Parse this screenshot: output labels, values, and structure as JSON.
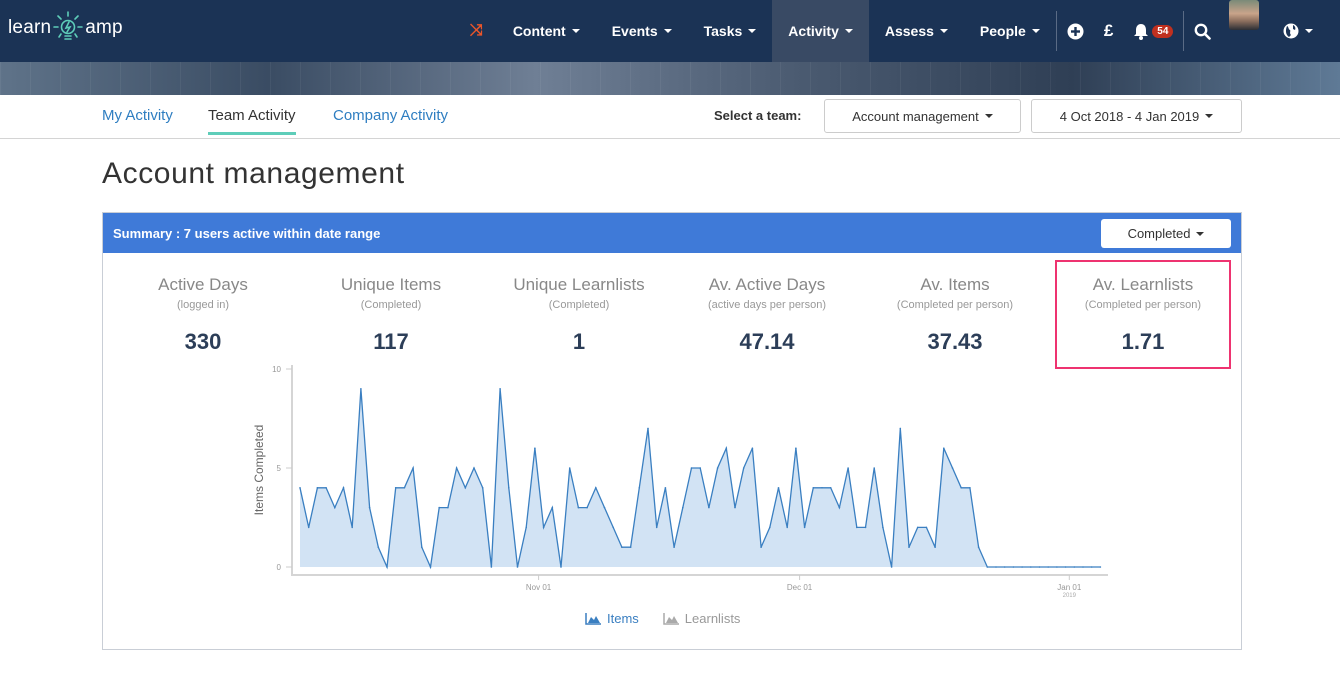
{
  "app": {
    "logo_left": "learn",
    "logo_right": "amp"
  },
  "nav": {
    "items": [
      {
        "label": "Content",
        "active": false
      },
      {
        "label": "Events",
        "active": false
      },
      {
        "label": "Tasks",
        "active": false
      },
      {
        "label": "Activity",
        "active": true
      },
      {
        "label": "Assess",
        "active": false
      },
      {
        "label": "People",
        "active": false
      }
    ],
    "icons": {
      "shuffle": "shuffle-icon",
      "add": "plus-circle-icon",
      "currency": "£",
      "bell": "bell-icon",
      "search": "search-icon",
      "globe": "globe-icon"
    },
    "notification_count": "54"
  },
  "tabs": [
    {
      "label": "My Activity",
      "active": false
    },
    {
      "label": "Team Activity",
      "active": true
    },
    {
      "label": "Company Activity",
      "active": false
    }
  ],
  "filters": {
    "team_label": "Select a team:",
    "team_value": "Account management",
    "date_range": "4 Oct 2018 - 4 Jan 2019"
  },
  "page_title": "Account management",
  "summary": {
    "header": "Summary : 7 users active within date range",
    "mode": "Completed",
    "stats": [
      {
        "title": "Active Days",
        "sub": "(logged in)",
        "value": "330"
      },
      {
        "title": "Unique Items",
        "sub": "(Completed)",
        "value": "117"
      },
      {
        "title": "Unique Learnlists",
        "sub": "(Completed)",
        "value": "1"
      },
      {
        "title": "Av. Active Days",
        "sub": "(active days per person)",
        "value": "47.14"
      },
      {
        "title": "Av. Items",
        "sub": "(Completed per person)",
        "value": "37.43"
      },
      {
        "title": "Av. Learnlists",
        "sub": "(Completed per person)",
        "value": "1.71"
      }
    ],
    "highlight_color": "#ee3370",
    "header_color": "#3f7ad8"
  },
  "chart_data": {
    "type": "area",
    "ylabel": "Items Completed",
    "xlabel": "",
    "ylim": [
      0,
      10
    ],
    "yticks": [
      "0",
      "5",
      "10"
    ],
    "x_start": "2018-10-04",
    "x_end": "2019-01-04",
    "xticks": [
      {
        "label": "Nov 01",
        "sub": "",
        "day_index": 28
      },
      {
        "label": "Dec 01",
        "sub": "",
        "day_index": 58
      },
      {
        "label": "Jan 01",
        "sub": "2019",
        "day_index": 89
      }
    ],
    "series": [
      {
        "name": "Items",
        "active": true,
        "color": "#3a7fc1",
        "values": [
          4,
          2,
          4,
          4,
          3,
          4,
          2,
          9,
          3,
          1,
          0,
          4,
          4,
          5,
          1,
          0,
          3,
          3,
          5,
          4,
          5,
          4,
          0,
          9,
          4,
          0,
          2,
          6,
          2,
          3,
          0,
          5,
          3,
          3,
          4,
          3,
          2,
          1,
          1,
          4,
          7,
          2,
          4,
          1,
          3,
          5,
          5,
          3,
          5,
          6,
          3,
          5,
          6,
          1,
          2,
          4,
          2,
          6,
          2,
          4,
          4,
          4,
          3,
          5,
          2,
          2,
          5,
          2,
          0,
          7,
          1,
          2,
          2,
          1,
          6,
          5,
          4,
          4,
          1,
          0,
          0,
          0,
          0,
          0,
          0,
          0,
          0,
          0,
          0,
          0,
          0,
          0,
          0
        ]
      },
      {
        "name": "Learnlists",
        "active": false,
        "color": "#aaaaaa",
        "values": []
      }
    ],
    "legend": "bottom-center"
  }
}
